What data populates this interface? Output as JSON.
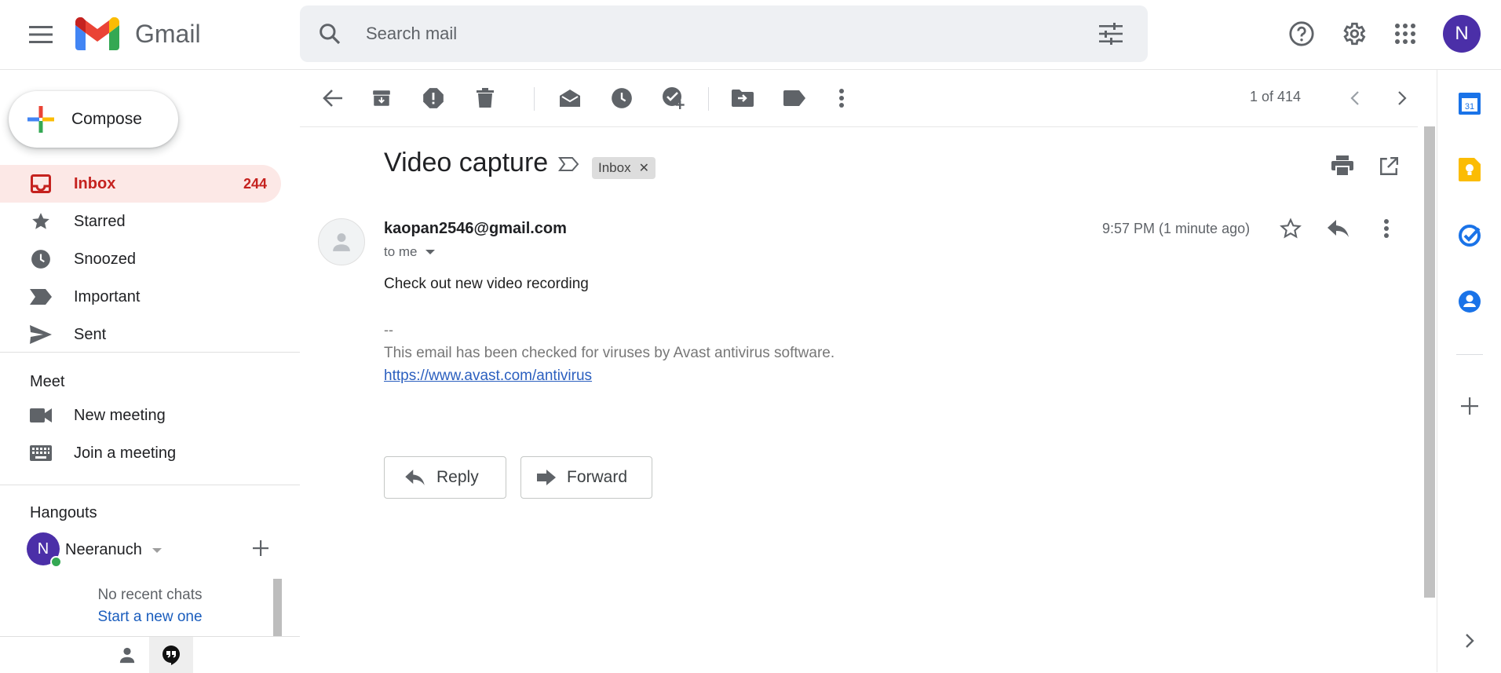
{
  "header": {
    "brand": "Gmail",
    "search_placeholder": "Search mail",
    "avatar_letter": "N"
  },
  "sidebar": {
    "compose_label": "Compose",
    "items": [
      {
        "label": "Inbox",
        "count": "244",
        "icon": "inbox-icon",
        "active": true
      },
      {
        "label": "Starred",
        "icon": "star-icon"
      },
      {
        "label": "Snoozed",
        "icon": "clock-icon"
      },
      {
        "label": "Important",
        "icon": "important-icon"
      },
      {
        "label": "Sent",
        "icon": "send-icon"
      }
    ],
    "meet": {
      "title": "Meet",
      "items": [
        {
          "label": "New meeting",
          "icon": "video-icon"
        },
        {
          "label": "Join a meeting",
          "icon": "keyboard-icon"
        }
      ]
    },
    "hangouts": {
      "title": "Hangouts",
      "user": "Neeranuch",
      "avatar_letter": "N",
      "empty_text": "No recent chats",
      "start_link": "Start a new one"
    }
  },
  "toolbar": {
    "pager": "1 of 414"
  },
  "email": {
    "subject": "Video capture",
    "label_chip": "Inbox",
    "sender": "kaopan2546@gmail.com",
    "to": "to me",
    "time": "9:57 PM (1 minute ago)",
    "body": "Check out new video recording",
    "sig_dash": "--",
    "sig_text": "This email has been checked for viruses by Avast antivirus software.",
    "sig_link": "https://www.avast.com/antivirus",
    "reply_label": "Reply",
    "forward_label": "Forward"
  },
  "colors": {
    "accent_red": "#c5221f",
    "active_bg": "#fce8e6",
    "avatar": "#4b2fa8",
    "link": "#2b5fbf"
  }
}
